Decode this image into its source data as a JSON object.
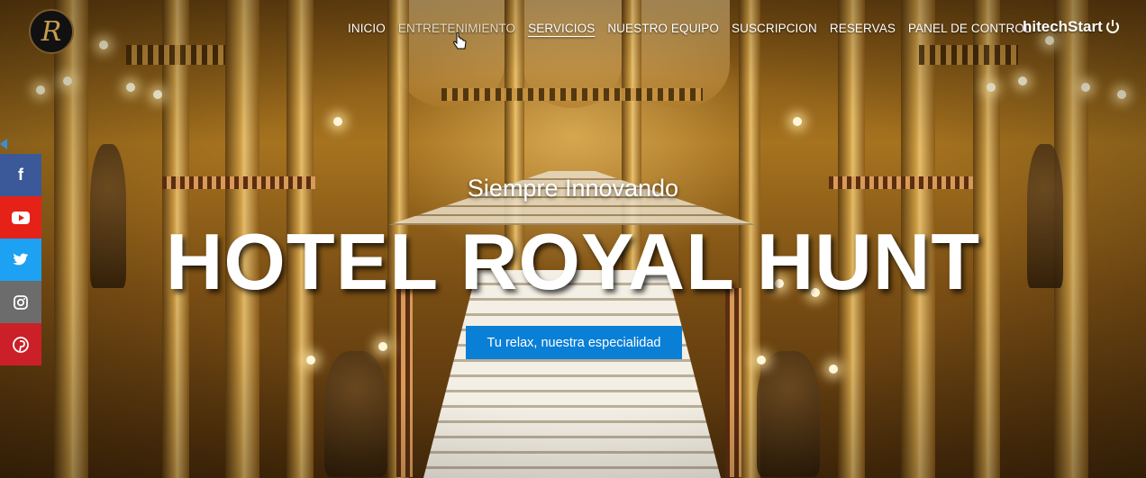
{
  "logo": {
    "letter": "R"
  },
  "nav": {
    "items": [
      {
        "label": "INICIO"
      },
      {
        "label": "ENTRETENIMIENTO"
      },
      {
        "label": "SERVICIOS"
      },
      {
        "label": "NUESTRO EQUIPO"
      },
      {
        "label": "SUSCRIPCION"
      },
      {
        "label": "RESERVAS"
      },
      {
        "label": "PANEL DE CONTROL"
      }
    ],
    "brand_right": "hitechStart",
    "power_icon": "power-icon"
  },
  "social": {
    "items": [
      {
        "icon": "facebook-icon",
        "glyph": "f"
      },
      {
        "icon": "youtube-icon",
        "glyph": "▶"
      },
      {
        "icon": "twitter-icon",
        "glyph": "✦"
      },
      {
        "icon": "instagram-icon",
        "glyph": "◎"
      },
      {
        "icon": "pinterest-icon",
        "glyph": "℗"
      }
    ]
  },
  "hero": {
    "tagline": "Siempre Innovando",
    "title": "HOTEL ROYAL HUNT",
    "cta_label": "Tu relax, nuestra especialidad"
  },
  "colors": {
    "cta": "#0a7fd6",
    "facebook": "#3b5998",
    "youtube": "#e62117",
    "twitter": "#1da1f2",
    "instagram": "#6c6c6c",
    "pinterest": "#cb2027"
  }
}
